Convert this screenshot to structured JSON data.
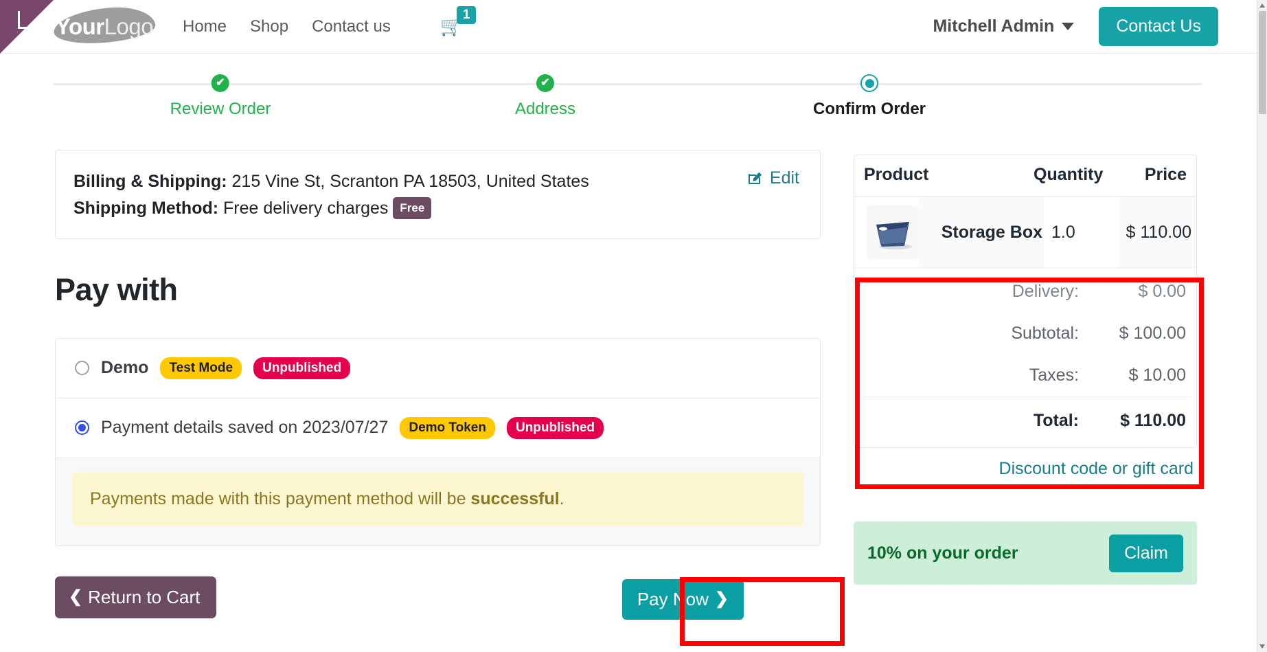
{
  "header": {
    "logo": {
      "bold": "Your",
      "light": "Logo"
    },
    "nav": [
      {
        "label": "Home"
      },
      {
        "label": "Shop"
      },
      {
        "label": "Contact us"
      }
    ],
    "cart": {
      "icon": "cart-icon",
      "count": "1"
    },
    "user": {
      "name": "Mitchell Admin",
      "icon": "chevron-down-icon"
    },
    "contact_button": "Contact Us"
  },
  "stepper": {
    "steps": [
      {
        "label": "Review Order",
        "state": "done"
      },
      {
        "label": "Address",
        "state": "done"
      },
      {
        "label": "Confirm Order",
        "state": "current"
      }
    ]
  },
  "address_card": {
    "billing_label": "Billing & Shipping:",
    "billing_value": " 215 Vine St, Scranton PA 18503, United States",
    "shipping_label": "Shipping Method:",
    "shipping_value": " Free delivery charges",
    "shipping_badge": "Free",
    "edit_label": "Edit",
    "edit_icon": "pencil-square-icon"
  },
  "payment": {
    "heading": "Pay with",
    "options": [
      {
        "name": "Demo",
        "selected": false,
        "badges": [
          {
            "text": "Test Mode",
            "style": "test"
          },
          {
            "text": "Unpublished",
            "style": "unpublished"
          }
        ]
      },
      {
        "name": "Payment details saved on 2023/07/27",
        "selected": true,
        "badges": [
          {
            "text": "Demo Token",
            "style": "test"
          },
          {
            "text": "Unpublished",
            "style": "unpublished"
          }
        ]
      }
    ],
    "alert_prefix": "Payments made with this payment method will be ",
    "alert_strong": "successful",
    "alert_suffix": "."
  },
  "actions": {
    "return_label": "Return to Cart",
    "return_icon": "chevron-left-icon",
    "pay_label": "Pay Now",
    "pay_icon": "chevron-right-icon"
  },
  "summary": {
    "columns": {
      "product": "Product",
      "quantity": "Quantity",
      "price": "Price"
    },
    "lines": [
      {
        "image": "storage-box-thumbnail",
        "name": "Storage Box",
        "quantity": "1.0",
        "price": "$ 110.00"
      }
    ],
    "totals": [
      {
        "label": "Delivery:",
        "value": "$ 0.00",
        "kind": "delivery"
      },
      {
        "label": "Subtotal:",
        "value": "$ 100.00",
        "kind": "normal"
      },
      {
        "label": "Taxes:",
        "value": "$ 10.00",
        "kind": "normal"
      },
      {
        "label": "Total:",
        "value": "$ 110.00",
        "kind": "grand"
      }
    ],
    "discount_link": "Discount code or gift card",
    "promo": {
      "text": "10% on your order",
      "button": "Claim"
    }
  },
  "colors": {
    "accent_teal": "#17a2a8",
    "button_teal": "#0b9ea3",
    "ribbon_purple": "#78456c",
    "step_done_green": "#21b24b",
    "badge_yellow": "#ffc800",
    "badge_crimson": "#e5004c",
    "alert_yellow_bg": "#fcf6d1",
    "promo_green_bg": "#cdeed9",
    "annotation_red": "#ff0000"
  }
}
